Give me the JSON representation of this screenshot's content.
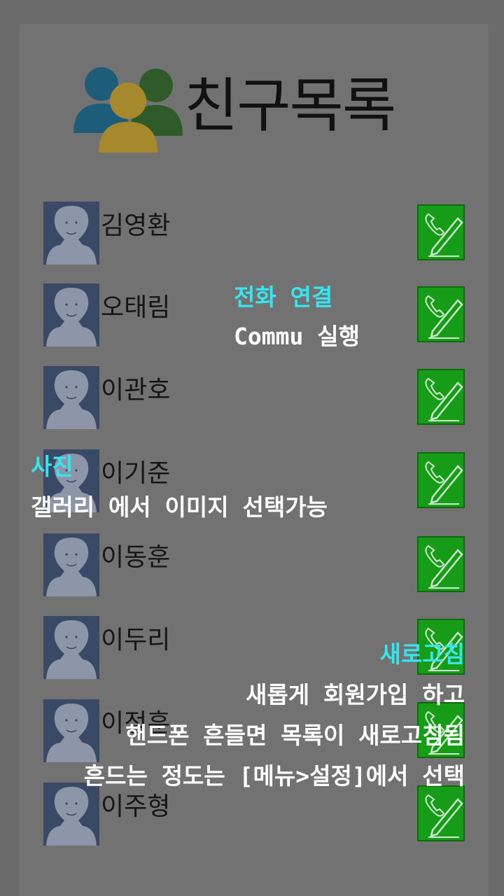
{
  "header": {
    "title": "친구목록",
    "icon": "people-group-icon"
  },
  "friends": [
    {
      "name": "김영환"
    },
    {
      "name": "오태림"
    },
    {
      "name": "이관호"
    },
    {
      "name": "이기준"
    },
    {
      "name": "이동훈"
    },
    {
      "name": "이두리"
    },
    {
      "name": "이정훈"
    },
    {
      "name": "이주형"
    }
  ],
  "row_icons": {
    "avatar": "person-silhouette-icon",
    "action": "phone-pencil-icon"
  },
  "overlay": {
    "call": {
      "title": "전화 연결",
      "desc": "Commu 실행"
    },
    "photo": {
      "title": "사진",
      "desc": "갤러리 에서 이미지 선택가능"
    },
    "refresh": {
      "title": "새로고침",
      "line1": "새롭게 회원가입 하고",
      "line2": "핸드폰 흔들면 목록이 새로고침됨",
      "line3": "흔드는 정도는 [메뉴>설정]에서 선택"
    }
  },
  "colors": {
    "accent_title": "#35e6ef",
    "call_button": "#169c16",
    "overlay_bg": "#6b6b6b"
  }
}
